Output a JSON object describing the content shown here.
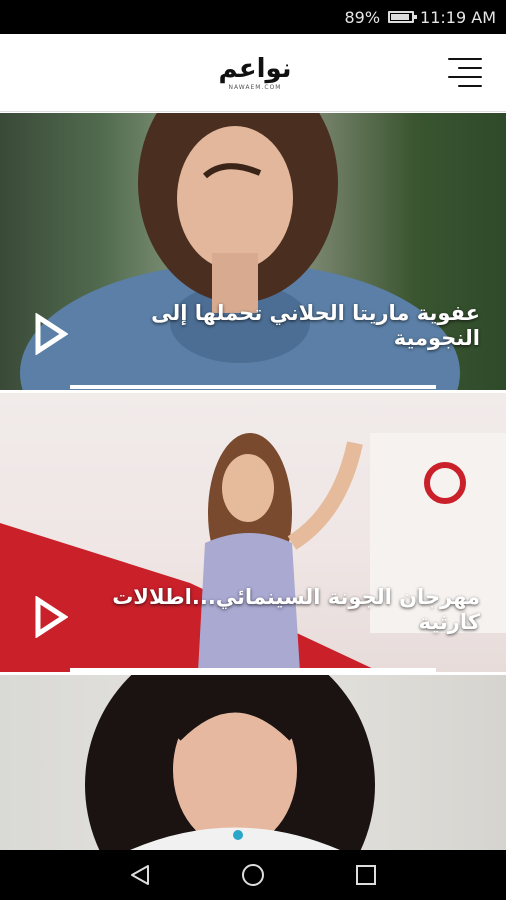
{
  "status_bar": {
    "battery_percent": "89%",
    "time": "11:19 AM",
    "battery_level": 0.89
  },
  "header": {
    "logo_text": "نواعم",
    "logo_subtext": "NAWAEM.COM",
    "menu_icon": "hamburger-menu-icon"
  },
  "articles": [
    {
      "title": "عفوية ماريتا الحلاني تحملها إلى النجومية",
      "icon": "play-icon"
    },
    {
      "title": "مهرجان الجونة السينمائي...اطلالات كارثية",
      "icon": "play-icon"
    },
    {
      "title": "",
      "icon": ""
    }
  ],
  "nav_bar": {
    "back_icon": "back-triangle-icon",
    "home_icon": "home-circle-icon",
    "recents_icon": "recents-square-icon"
  },
  "colors": {
    "status_bar_bg": "#000000",
    "header_bg": "#ffffff",
    "nav_bar_bg": "#000000",
    "text_on_image": "#ffffff"
  }
}
